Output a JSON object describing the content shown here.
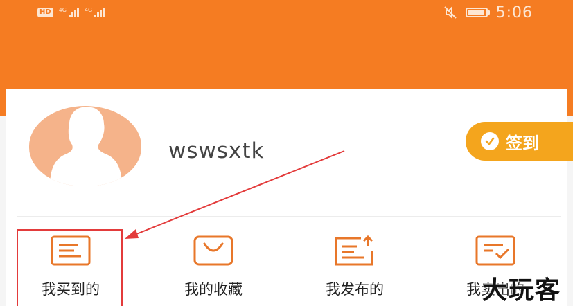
{
  "status_bar": {
    "network_badge": "HD",
    "signal1_label": "4G",
    "signal2_label": "4G",
    "time": "5:06",
    "icons": [
      "mute-icon",
      "battery-icon"
    ]
  },
  "profile": {
    "username": "wswsxtk",
    "checkin_label": "签到",
    "avatar_icon": "default-avatar-icon"
  },
  "menu": {
    "items": [
      {
        "label": "我买到的",
        "icon": "receipt-icon"
      },
      {
        "label": "我的收藏",
        "icon": "bag-icon"
      },
      {
        "label": "我发布的",
        "icon": "post-up-icon"
      },
      {
        "label": "我卖出的",
        "icon": "check-doc-icon"
      }
    ],
    "highlighted_index": 0
  },
  "watermark": "大玩客",
  "colors": {
    "header": "#f57c22",
    "accent": "#f4a51d",
    "icon_stroke": "#e8772a",
    "annotation": "#e33b3b"
  }
}
